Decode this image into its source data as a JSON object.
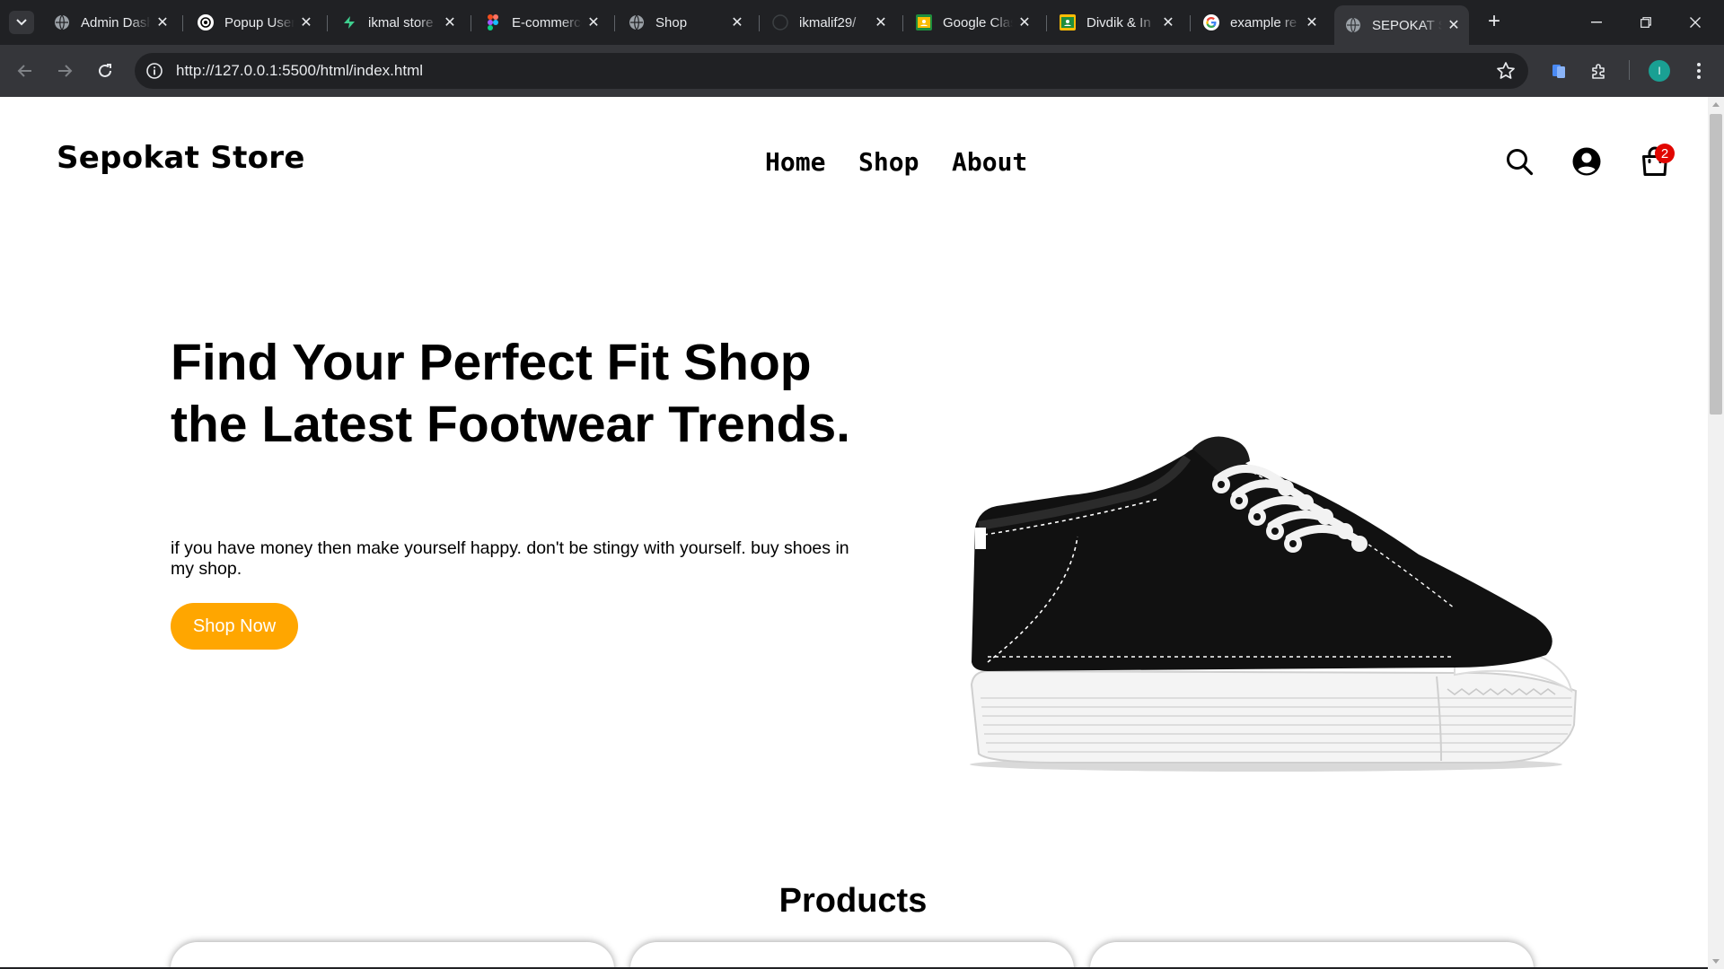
{
  "browser": {
    "tabs": [
      {
        "title": "Admin Dashboard",
        "favicon": "globe-icon"
      },
      {
        "title": "Popup User",
        "favicon": "openai-icon"
      },
      {
        "title": "ikmal store",
        "favicon": "supabase-icon"
      },
      {
        "title": "E-commerce",
        "favicon": "figma-icon"
      },
      {
        "title": "Shop",
        "favicon": "globe-icon"
      },
      {
        "title": "ikmalif29/",
        "favicon": "github-icon"
      },
      {
        "title": "Google Classroom",
        "favicon": "classroom-icon"
      },
      {
        "title": "Divdik & In",
        "favicon": "classroom-icon"
      },
      {
        "title": "example re",
        "favicon": "google-icon"
      },
      {
        "title": "SEPOKAT S",
        "favicon": "globe-icon",
        "active": true
      }
    ],
    "url": "http://127.0.0.1:5500/html/index.html",
    "profile_initial": "I",
    "colors": {
      "tabbar": "#202124",
      "toolbar": "#35363a",
      "profile": "#1aa093"
    }
  },
  "header": {
    "logo": "Sepokat Store",
    "nav": [
      "Home",
      "Shop",
      "About"
    ],
    "cart_count": "2",
    "icons": [
      "search-icon",
      "user-icon",
      "shopping-bag-icon"
    ]
  },
  "hero": {
    "title": "Find Your Perfect Fit Shop the Latest Footwear Trends.",
    "text": "if you have money then make yourself happy. don't be stingy with yourself. buy shoes in my shop.",
    "cta": "Shop Now",
    "cta_color": "#ffa600",
    "image": "black-canvas-sneaker"
  },
  "products": {
    "title": "Products"
  }
}
